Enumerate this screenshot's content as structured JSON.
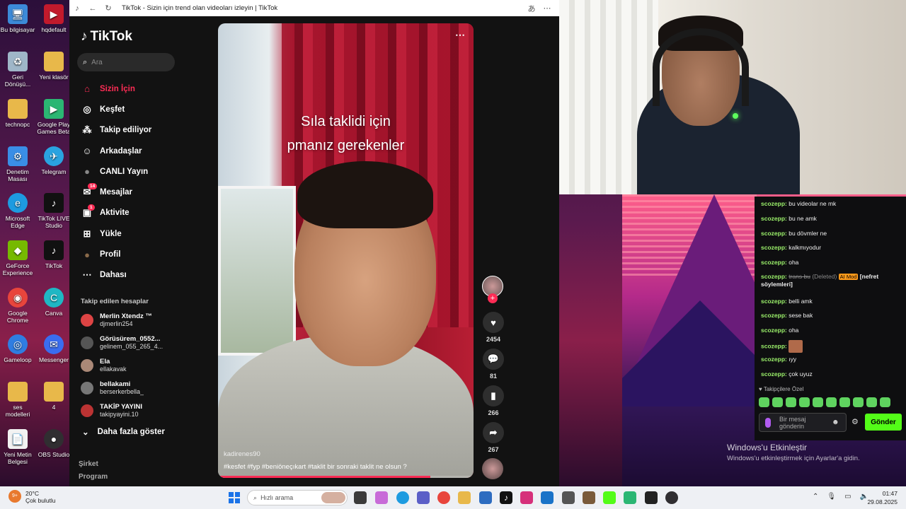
{
  "desktop": {
    "icons": [
      {
        "label": "Bu bilgisayar",
        "glyph": "🖥"
      },
      {
        "label": "hqdefault",
        "glyph": "▶"
      },
      {
        "label": "Geri Dönüşü...",
        "glyph": "♻"
      },
      {
        "label": "Yeni klasör",
        "glyph": "📁"
      },
      {
        "label": "technopc",
        "glyph": "📁"
      },
      {
        "label": "Google Play Games Beta",
        "glyph": "▶"
      },
      {
        "label": "Denetim Masası",
        "glyph": "⚙"
      },
      {
        "label": "Telegram",
        "glyph": "✈"
      },
      {
        "label": "Microsoft Edge",
        "glyph": "e"
      },
      {
        "label": "TikTok LIVE Studio",
        "glyph": "♪"
      },
      {
        "label": "GeForce Experience",
        "glyph": "◆"
      },
      {
        "label": "TikTok",
        "glyph": "♪"
      },
      {
        "label": "Google Chrome",
        "glyph": "◉"
      },
      {
        "label": "Canva",
        "glyph": "C"
      },
      {
        "label": "Gameloop",
        "glyph": "◎"
      },
      {
        "label": "Messenger",
        "glyph": "✉"
      },
      {
        "label": "ses modelleri",
        "glyph": "📁"
      },
      {
        "label": "4",
        "glyph": "📁"
      },
      {
        "label": "Yeni Metin Belgesi",
        "glyph": "📄"
      },
      {
        "label": "OBS Studio",
        "glyph": "●"
      }
    ]
  },
  "browser": {
    "tab_title": "TikTok - Sizin için trend olan videoları izleyin | TikTok",
    "back_icon": "←",
    "reload_icon": "↻",
    "menu_icon": "⋯",
    "translate_icon": "あ"
  },
  "tiktok": {
    "logo": "TikTok",
    "search_placeholder": "Ara",
    "nav": [
      {
        "label": "Sizin İçin",
        "icon": "⌂",
        "active": true
      },
      {
        "label": "Keşfet",
        "icon": "◎"
      },
      {
        "label": "Takip ediliyor",
        "icon": "⁂"
      },
      {
        "label": "Arkadaşlar",
        "icon": "☺"
      },
      {
        "label": "CANLI Yayın",
        "icon": "●"
      },
      {
        "label": "Mesajlar",
        "icon": "✉",
        "badge": "14"
      },
      {
        "label": "Aktivite",
        "icon": "▣",
        "badge": "1"
      },
      {
        "label": "Yükle",
        "icon": "⊞"
      },
      {
        "label": "Profil",
        "icon": "●"
      },
      {
        "label": "Dahası",
        "icon": "⋯"
      }
    ],
    "followed_title": "Takip edilen hesaplar",
    "accounts": [
      {
        "name": "Merlin Xtendz ™",
        "user": "djmerlin254"
      },
      {
        "name": "Görüsürem_0552...",
        "user": "gelinem_055_265_4..."
      },
      {
        "name": "Ela",
        "user": "ellakavak"
      },
      {
        "name": "bellakami",
        "user": "berserkerbella_"
      },
      {
        "name": "TAKİP YAYINI",
        "user": "takipyayini.10"
      }
    ],
    "more_label": "Daha fazla göster",
    "footer": [
      "Şirket",
      "Program"
    ],
    "video": {
      "caption_line1": "Sıla taklidi için",
      "caption_line2": "pmanız gerekenler",
      "author": "kadirenes90",
      "tags": "#kesfet  #fyp  #beniöneçıkart  #taklit  bir sonraki taklit ne olsun ?",
      "progress": 0.83
    },
    "actions": {
      "likes": "2454",
      "comments": "81",
      "saves": "266",
      "shares": "267"
    }
  },
  "chat": {
    "messages": [
      {
        "user": "scozepp:",
        "text": "bu videolar ne mk"
      },
      {
        "user": "scozepp:",
        "text": "bu ne amk"
      },
      {
        "user": "scozepp:",
        "text": "bu dövmler ne"
      },
      {
        "user": "scozepp:",
        "text": "kalkmıyodur"
      },
      {
        "user": "scozepp:",
        "text": "oha"
      },
      {
        "user": "scozepp:",
        "deleted": "trans bu",
        "mark": "(Deleted)",
        "mod": "AI Mod",
        "reason": "[nefret söylemleri]"
      },
      {
        "user": "scozepp:",
        "text": "belli amk"
      },
      {
        "user": "scozepp:",
        "text": "sese bak"
      },
      {
        "user": "scozepp:",
        "text": "oha"
      },
      {
        "user": "scozepp:",
        "text": "",
        "emote": true
      },
      {
        "user": "scozepp:",
        "text": "ıyy"
      },
      {
        "user": "scozepp:",
        "text": "çok uyuz"
      }
    ],
    "subscribers_label": "♥ Takipçilere Özel",
    "input_placeholder": "Bir mesaj gönderin",
    "send_label": "Gönder"
  },
  "activation": {
    "line1": "Windows'u Etkinleştir",
    "line2": "Windows'u etkinleştirmek için Ayarlar'a gidin."
  },
  "taskbar": {
    "weather_temp": "20°C",
    "weather_desc": "Çok bulutlu",
    "weather_badge": "9+",
    "search_placeholder": "Hızlı arama",
    "time": "01:47",
    "date": "29.08.2025"
  },
  "colors": {
    "tiktok_red": "#fe2c55",
    "kick_green": "#53fc18"
  }
}
